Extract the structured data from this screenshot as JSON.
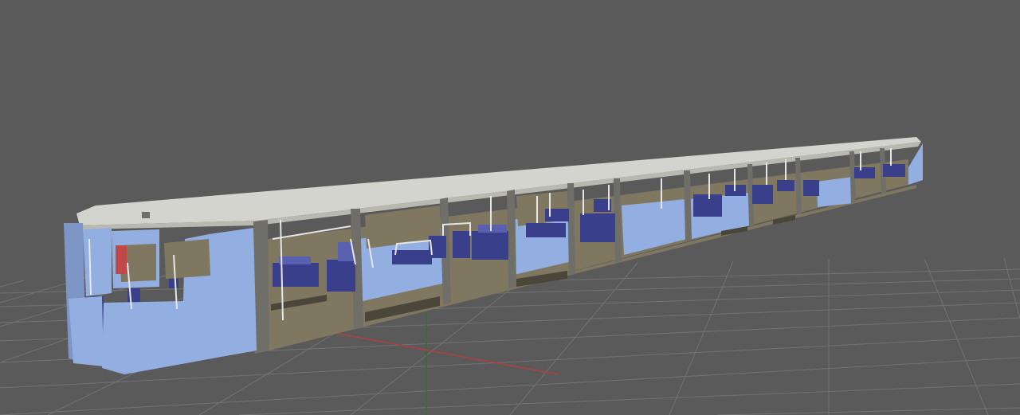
{
  "viewport": {
    "background_color": "#5a5a5a",
    "grid_color": "#737373",
    "x_axis_color": "#b04040",
    "y_axis_color": "#2d6f3a"
  },
  "train": {
    "body_color": "#93aee0",
    "body_shadow_color": "#7e96c6",
    "roof_color": "#d4d4ce",
    "roof_shade_color": "#b9b8b1",
    "frame_color": "#6f6e69",
    "interior_floor_color": "#7f7760",
    "seat_color": "#3a3f8c",
    "seat_highlight_color": "#5a60b0",
    "rail_color": "#e6e6e6"
  }
}
